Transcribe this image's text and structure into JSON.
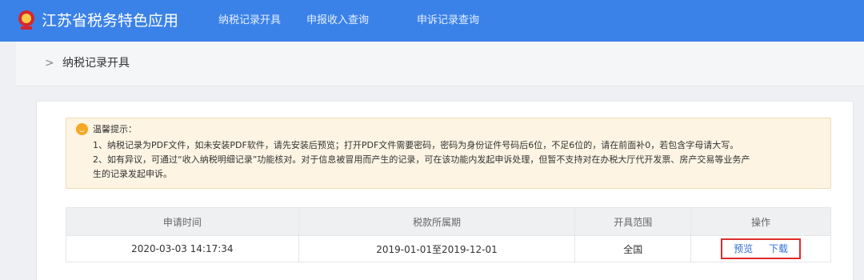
{
  "header": {
    "app_title": "江苏省税务特色应用",
    "nav": [
      {
        "label": "纳税记录开具"
      },
      {
        "label": "申报收入查询"
      },
      {
        "label": "申诉记录查询"
      }
    ],
    "accent_color": "#3b82e8"
  },
  "breadcrumb": {
    "arrow": ">",
    "label": "纳税记录开具"
  },
  "tip": {
    "title": "温馨提示：",
    "line1": "1、纳税记录为PDF文件，如未安装PDF软件，请先安装后预览；打开PDF文件需要密码，密码为身份证件号码后6位，不足6位的，请在前面补0，若包含字母请大写。",
    "line2": "2、如有异议，可通过“收入纳税明细记录”功能核对。对于信息被冒用而产生的记录，可在该功能内发起申诉处理，但暂不支持对在办税大厅代开发票、房产交易等业务产",
    "line3": "生的记录发起申诉。",
    "icon": "smile-icon"
  },
  "table": {
    "headers": [
      "申请时间",
      "税款所属期",
      "开具范围",
      "操作"
    ],
    "rows": [
      {
        "apply_time": "2020-03-03 14:17:34",
        "period": "2019-01-01至2019-12-01",
        "scope": "全国",
        "preview": "预览",
        "download": "下载"
      }
    ]
  }
}
